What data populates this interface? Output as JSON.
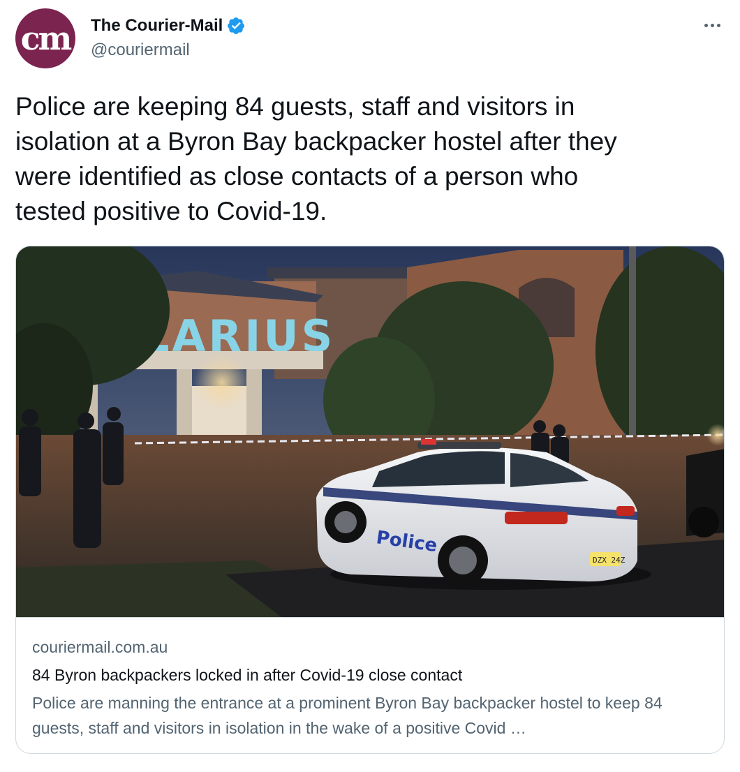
{
  "author": {
    "avatar_text": "cm",
    "display_name": "The Courier-Mail",
    "handle": "@couriermail",
    "verified_icon": "verified-badge-icon",
    "avatar_color": "#7b2450",
    "verified_color": "#1d9bf0"
  },
  "more_icon": "more-options-icon",
  "tweet": {
    "text": "Police are keeping 84 guests, staff and visitors in\nisolation at a Byron Bay backpacker hostel after they\nwere identified as close contacts of a person who\ntested positive to Covid-19."
  },
  "card": {
    "image": {
      "sign_text": "LARIUS",
      "car_text": "Police",
      "plate_text": "DZX 24Z"
    },
    "domain": "couriermail.com.au",
    "title": "84 Byron backpackers locked in after Covid-19 close contact",
    "description": "Police are manning the entrance at a prominent Byron Bay backpacker hostel to keep 84 guests, staff and visitors in isolation in the wake of a positive Covid …"
  }
}
